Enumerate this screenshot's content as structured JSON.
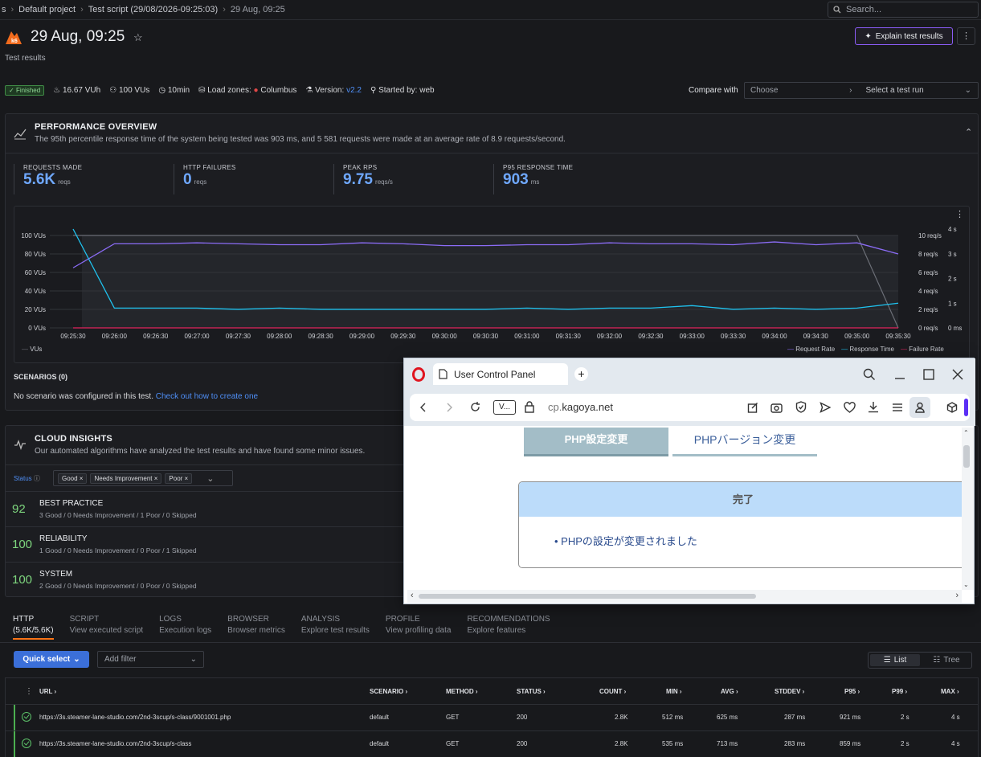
{
  "breadcrumb": [
    "s",
    "Default project",
    "Test script (29/08/2026-09:25:03)",
    "29 Aug, 09:25"
  ],
  "search_placeholder": "Search...",
  "header": {
    "title": "29 Aug, 09:25",
    "subtitle": "Test results",
    "explain_button": "Explain test results"
  },
  "meta": {
    "status": "Finished",
    "vuh": "16.67 VUh",
    "vus": "100 VUs",
    "duration": "10min",
    "load_zones_label": "Load zones:",
    "load_zone": "Columbus",
    "version_label": "Version:",
    "version": "v2.2",
    "started_label": "Started by: web"
  },
  "compare": {
    "label": "Compare with",
    "choose": "Choose",
    "select_run": "Select a test run"
  },
  "performance": {
    "title": "PERFORMANCE OVERVIEW",
    "description": "The 95th percentile response time of the system being tested was 903 ms, and 5 581 requests were made at an average rate of 8.9 requests/second.",
    "stats": [
      {
        "label": "REQUESTS MADE",
        "value": "5.6K",
        "unit": "reqs"
      },
      {
        "label": "HTTP FAILURES",
        "value": "0",
        "unit": "reqs"
      },
      {
        "label": "PEAK RPS",
        "value": "9.75",
        "unit": "reqs/s"
      },
      {
        "label": "P95 RESPONSE TIME",
        "value": "903",
        "unit": "ms"
      }
    ]
  },
  "chart_data": {
    "type": "line",
    "x": [
      "09:25:30",
      "09:26:00",
      "09:26:30",
      "09:27:00",
      "09:27:30",
      "09:28:00",
      "09:28:30",
      "09:29:00",
      "09:29:30",
      "09:30:00",
      "09:30:30",
      "09:31:00",
      "09:31:30",
      "09:32:00",
      "09:32:30",
      "09:33:00",
      "09:33:30",
      "09:34:00",
      "09:34:30",
      "09:35:00",
      "09:35:30"
    ],
    "y_left_ticks": [
      "100 VUs",
      "80 VUs",
      "60 VUs",
      "40 VUs",
      "20 VUs",
      "0 VUs"
    ],
    "y_right_rps_ticks": [
      "10 req/s",
      "8 req/s",
      "6 req/s",
      "4 req/s",
      "2 req/s",
      "0 req/s"
    ],
    "y_right_time_ticks": [
      "4 s",
      "3 s",
      "2 s",
      "1 s",
      "0 ms"
    ],
    "series": [
      {
        "name": "VUs",
        "color": "#6b6e76",
        "values": [
          100,
          100,
          100,
          100,
          100,
          100,
          100,
          100,
          100,
          100,
          100,
          100,
          100,
          100,
          100,
          100,
          100,
          100,
          100,
          100,
          0
        ]
      },
      {
        "name": "Request Rate",
        "color": "#8b6cf6",
        "values": [
          6.5,
          9.1,
          9.1,
          9.2,
          9.1,
          9.0,
          9.0,
          9.2,
          9.1,
          8.9,
          8.9,
          9.0,
          9.0,
          9.2,
          9.1,
          9.1,
          9.0,
          9.3,
          9.0,
          9.2,
          8.0
        ]
      },
      {
        "name": "Response Time",
        "color": "#1fc3f0",
        "values": [
          4.0,
          0.8,
          0.8,
          0.8,
          0.75,
          0.8,
          0.75,
          0.75,
          0.75,
          0.75,
          0.75,
          0.8,
          0.75,
          0.8,
          0.8,
          0.9,
          0.75,
          0.8,
          0.75,
          0.8,
          1.0
        ]
      },
      {
        "name": "Failure Rate",
        "color": "#e0245e",
        "values": [
          0,
          0,
          0,
          0,
          0,
          0,
          0,
          0,
          0,
          0,
          0,
          0,
          0,
          0,
          0,
          0,
          0,
          0,
          0,
          0,
          0
        ]
      }
    ]
  },
  "legend": {
    "vus": "VUs",
    "request_rate": "Request Rate",
    "response_time": "Response Time",
    "failure_rate": "Failure Rate"
  },
  "scenarios": {
    "title": "SCENARIOS (0)",
    "text": "No scenario was configured in this test.",
    "link": "Check out how to create one"
  },
  "insights": {
    "title": "CLOUD INSIGHTS",
    "description": "Our automated algorithms have analyzed the test results and have found some minor issues.",
    "status_label": "Status",
    "chips": [
      "Good",
      "Needs Improvement",
      "Poor"
    ],
    "rows": [
      {
        "score": "92",
        "name": "BEST PRACTICE",
        "sub": "3 Good / 0 Needs Improvement / 1 Poor / 0 Skipped"
      },
      {
        "score": "100",
        "name": "RELIABILITY",
        "sub": "1 Good / 0 Needs Improvement / 0 Poor / 1 Skipped"
      },
      {
        "score": "100",
        "name": "SYSTEM",
        "sub": "2 Good / 0 Needs Improvement / 0 Poor / 0 Skipped"
      }
    ]
  },
  "tabs": [
    {
      "label": "HTTP",
      "sub": "(5.6K/5.6K)"
    },
    {
      "label": "SCRIPT",
      "sub": "View executed script"
    },
    {
      "label": "LOGS",
      "sub": "Execution logs"
    },
    {
      "label": "BROWSER",
      "sub": "Browser metrics"
    },
    {
      "label": "ANALYSIS",
      "sub": "Explore test results"
    },
    {
      "label": "PROFILE",
      "sub": "View profiling data"
    },
    {
      "label": "RECOMMENDATIONS",
      "sub": "Explore features"
    }
  ],
  "toolbar": {
    "quick_select": "Quick select",
    "add_filter": "Add filter",
    "list": "List",
    "tree": "Tree"
  },
  "table": {
    "headers": [
      "URL",
      "SCENARIO",
      "METHOD",
      "STATUS",
      "COUNT",
      "MIN",
      "AVG",
      "STDDEV",
      "P95",
      "P99",
      "MAX"
    ],
    "rows": [
      {
        "url": "https://3s.steamer-lane-studio.com/2nd-3scup/s-class/9001001.php",
        "scenario": "default",
        "method": "GET",
        "status": "200",
        "count": "2.8K",
        "min": "512 ms",
        "avg": "625 ms",
        "stddev": "287 ms",
        "p95": "921 ms",
        "p99": "2 s",
        "max": "4 s"
      },
      {
        "url": "https://3s.steamer-lane-studio.com/2nd-3scup/s-class",
        "scenario": "default",
        "method": "GET",
        "status": "200",
        "count": "2.8K",
        "min": "535 ms",
        "avg": "713 ms",
        "stddev": "283 ms",
        "p95": "859 ms",
        "p99": "2 s",
        "max": "4 s"
      }
    ]
  },
  "browser": {
    "tab_title": "User Control Panel",
    "tab_badge": "V...",
    "url_host_prefix": "cp.",
    "url_host": "kagoya.net",
    "page_tabs": [
      "PHP設定変更",
      "PHPバージョン変更"
    ],
    "box_title": "完了",
    "message": "PHPの設定が変更されました"
  }
}
